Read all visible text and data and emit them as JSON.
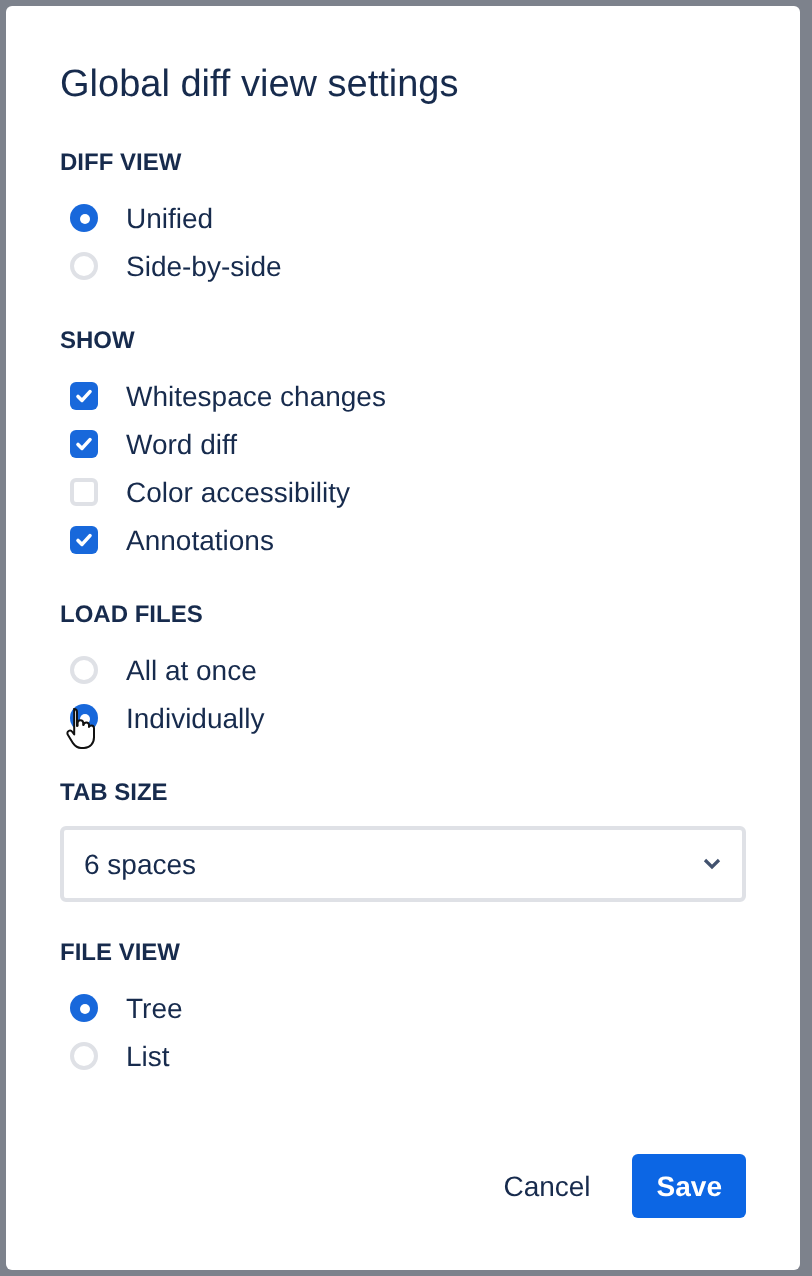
{
  "dialog": {
    "title": "Global diff view settings"
  },
  "sections": [
    {
      "kind": "radio",
      "heading": "DIFF VIEW",
      "options": [
        {
          "label": "Unified",
          "selected": true
        },
        {
          "label": "Side-by-side",
          "selected": false
        }
      ]
    },
    {
      "kind": "checkbox",
      "heading": "SHOW",
      "options": [
        {
          "label": "Whitespace changes",
          "checked": true
        },
        {
          "label": "Word diff",
          "checked": true
        },
        {
          "label": "Color accessibility",
          "checked": false
        },
        {
          "label": "Annotations",
          "checked": true
        }
      ]
    },
    {
      "kind": "radio",
      "heading": "LOAD FILES",
      "options": [
        {
          "label": "All at once",
          "selected": false
        },
        {
          "label": "Individually",
          "selected": true
        }
      ]
    },
    {
      "kind": "select",
      "heading": "TAB SIZE",
      "value": "6 spaces"
    },
    {
      "kind": "radio",
      "heading": "FILE VIEW",
      "options": [
        {
          "label": "Tree",
          "selected": true
        },
        {
          "label": "List",
          "selected": false
        }
      ]
    }
  ],
  "buttons": {
    "cancel": "Cancel",
    "save": "Save"
  }
}
